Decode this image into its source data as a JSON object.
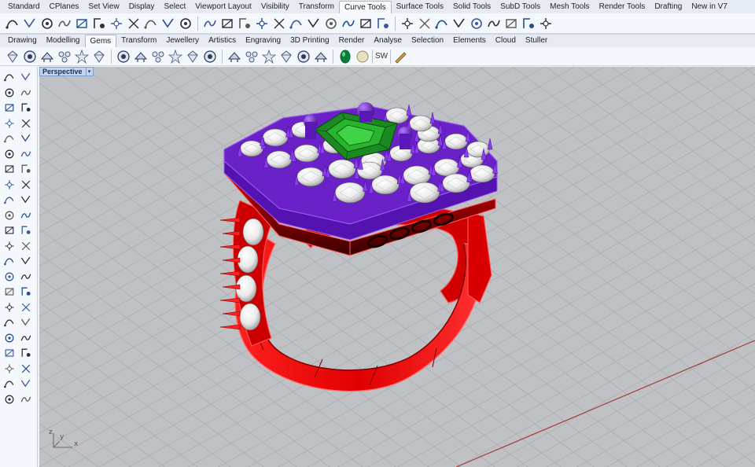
{
  "top_tabs": [
    "Standard",
    "CPlanes",
    "Set View",
    "Display",
    "Select",
    "Viewport Layout",
    "Visibility",
    "Transform",
    "Curve Tools",
    "Surface Tools",
    "Solid Tools",
    "SubD Tools",
    "Mesh Tools",
    "Render Tools",
    "Drafting",
    "New in V7"
  ],
  "top_tabs_active": "Curve Tools",
  "second_tabs": [
    "Drawing",
    "Modelling",
    "Gems",
    "Transform",
    "Jewellery",
    "Artistics",
    "Engraving",
    "3D Printing",
    "Render",
    "Analyse",
    "Selection",
    "Elements",
    "Cloud",
    "Stuller"
  ],
  "second_tabs_active": "Gems",
  "toolbar_sw_label": "SW",
  "viewport": {
    "label": "Perspective",
    "axes": {
      "x": "x",
      "y": "y",
      "z": "z"
    }
  },
  "colors": {
    "ring_red": "#ff1a1a",
    "prong_purple": "#7a2ed8",
    "emerald_green": "#1f9a24",
    "diamond_white": "#f2f2f2",
    "viewport_bg": "#bfc1c4",
    "grid_line": "#a9abae",
    "active_tab": "#c2d4ef"
  },
  "top_toolbar_icons": [
    "curve-icon",
    "arc-icon",
    "tee-icon",
    "blend-icon",
    "fillet-icon",
    "connect-icon",
    "wave-icon",
    "offset-icon",
    "extend-icon",
    "join-icon",
    "explode-icon",
    "rebuild-icon",
    "fit-icon",
    "dec-icon",
    "fair-icon",
    "simplify-icon",
    "project-icon",
    "pull-icon",
    "split-icon",
    "trim-icon",
    "point-icon",
    "delete-point-icon",
    "smooth-icon",
    "insert-knot-icon",
    "remove-knot-icon",
    "divide-icon",
    "weight-icon",
    "handle-icon",
    "cage-icon",
    "twist-icon",
    "analyze-icon"
  ],
  "second_toolbar_icons": [
    "gem-icon",
    "gem-cut-icon",
    "gem-array-icon",
    "gem-flow-icon",
    "gem-map-icon",
    "gem-settings-icon",
    "cutter-icon",
    "cutter-alt-icon",
    "prong-icon",
    "bezel-icon",
    "channel-icon",
    "pave-icon",
    "cluster-icon",
    "halo-icon",
    "star-icon",
    "seat-icon",
    "bead-icon",
    "pearl-icon",
    "emerald-icon",
    "round-gem-icon",
    "pen-icon"
  ],
  "sidebar_icons": [
    "select-icon",
    "points-icon",
    "curve-point-icon",
    "line-icon",
    "arc-icon",
    "rectangle-icon",
    "polygon-icon",
    "circle-icon",
    "ellipse-icon",
    "curve-icon",
    "freeform-icon",
    "spline-icon",
    "fillet-icon",
    "chamfer-icon",
    "offset-icon",
    "extend-icon",
    "split-icon",
    "trim-icon",
    "join-icon",
    "explode-icon",
    "rotate-icon",
    "move-icon",
    "copy-icon",
    "scale-icon",
    "mirror-icon",
    "array-icon",
    "box-icon",
    "sphere-icon",
    "cylinder-icon",
    "cone-icon",
    "torus-icon",
    "pipe-icon",
    "extrude-icon",
    "loft-icon",
    "revolve-icon",
    "sweep-icon",
    "boolean-icon",
    "shell-icon",
    "cap-icon",
    "dimension-icon",
    "text-icon",
    "hatch-icon",
    "layer-icon",
    "properties-icon"
  ]
}
